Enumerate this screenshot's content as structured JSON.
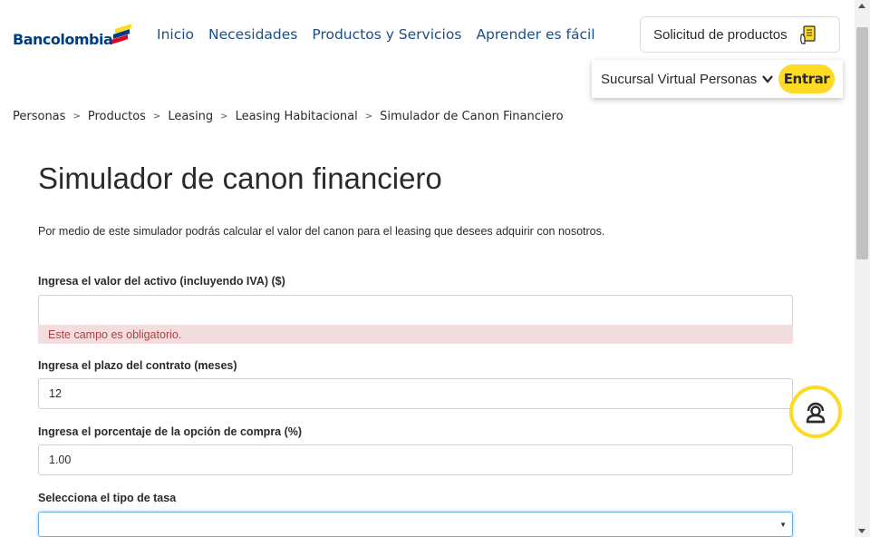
{
  "brand": {
    "logo_text": "Bancolombia"
  },
  "nav": {
    "items": [
      "Inicio",
      "Necesidades",
      "Productos y Servicios",
      "Aprender es fácil"
    ]
  },
  "header": {
    "solicitud_label": "Solicitud de productos",
    "sucursal_label": "Sucursal Virtual Personas",
    "entrar_label": "Entrar"
  },
  "breadcrumb": {
    "separator": ">",
    "items": [
      "Personas",
      "Productos",
      "Leasing",
      "Leasing Habitacional",
      "Simulador de Canon Financiero"
    ]
  },
  "page": {
    "title": "Simulador de canon financiero",
    "description": "Por medio de este simulador podrás calcular el valor del canon para el leasing que desees adquirir con nosotros."
  },
  "form": {
    "valor_label": "Ingresa el valor del activo (incluyendo IVA) ($)",
    "valor_value": "",
    "valor_error": "Este campo es obligatorio.",
    "plazo_label": "Ingresa el plazo del contrato (meses)",
    "plazo_value": "12",
    "opcion_label": "Ingresa el porcentaje de la opción de compra (%)",
    "opcion_value": "1.00",
    "tasa_label": "Selecciona el tipo de tasa",
    "tasa_value": ""
  },
  "colors": {
    "brand_yellow": "#fdda24",
    "brand_blue": "#003f7f",
    "brand_red": "#e4002b",
    "error_bg": "#f2dede",
    "error_text": "#a94442"
  },
  "icons": {
    "solicitud": "document-hand-icon",
    "sucursal": "chevron-down-icon",
    "chat": "chat-support-icon",
    "select": "caret-down-icon"
  }
}
